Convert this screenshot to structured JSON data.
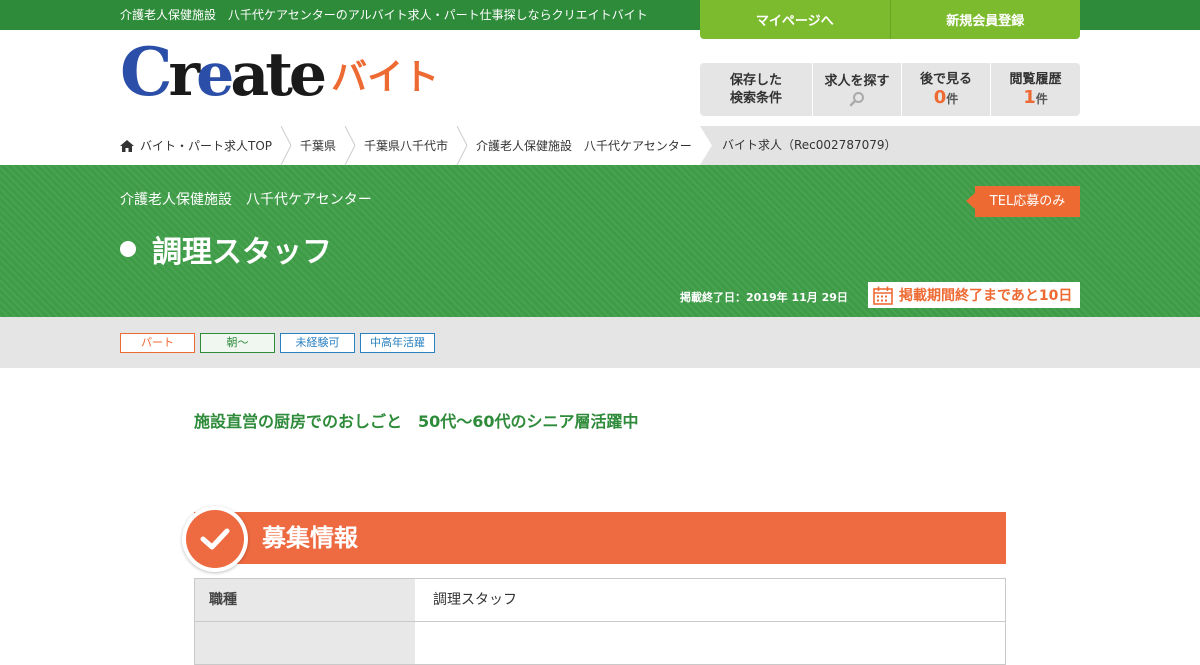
{
  "topbar": {
    "text": "介護老人保健施設　八千代ケアセンターのアルバイト求人・パート仕事探しならクリエイトバイト",
    "mypage_label": "マイページへ",
    "register_label": "新規会員登録"
  },
  "logo": {
    "create_c": "C",
    "create_r": "r",
    "create_e": "e",
    "create_rest": "ate",
    "baito": "バイト"
  },
  "quick_nav": {
    "saved_search_line1": "保存した",
    "saved_search_line2": "検索条件",
    "find_jobs": "求人を探す",
    "later_label": "後で見る",
    "later_count": "0",
    "later_unit": "件",
    "history_label": "閲覧履歴",
    "history_count": "1",
    "history_unit": "件"
  },
  "breadcrumb": {
    "items": [
      "バイト・パート求人TOP",
      "千葉県",
      "千葉県八千代市",
      "介護老人保健施設　八千代ケアセンター"
    ],
    "current": "バイト求人（Rec002787079）"
  },
  "job": {
    "facility": "介護老人保健施設　八千代ケアセンター",
    "title": "調理スタッフ",
    "tel_tag": "TEL応募のみ",
    "end_date": "掲載終了日：2019年 11月 29日",
    "remaining": "掲載期間終了まであと10日"
  },
  "tags": [
    "パート",
    "朝～",
    "未経験可",
    "中高年活躍"
  ],
  "catch_copy": "施設直営の厨房でのおしごと　50代～60代のシニア層活躍中",
  "section": {
    "title": "募集情報"
  },
  "info_rows": [
    {
      "th": "職種",
      "td": "調理スタッフ"
    },
    {
      "th": "",
      "td": ""
    }
  ],
  "colors": {
    "green": "#2e8b3a",
    "lime": "#7dbb2e",
    "orange": "#ee6a33",
    "blue": "#2b4fa8"
  }
}
